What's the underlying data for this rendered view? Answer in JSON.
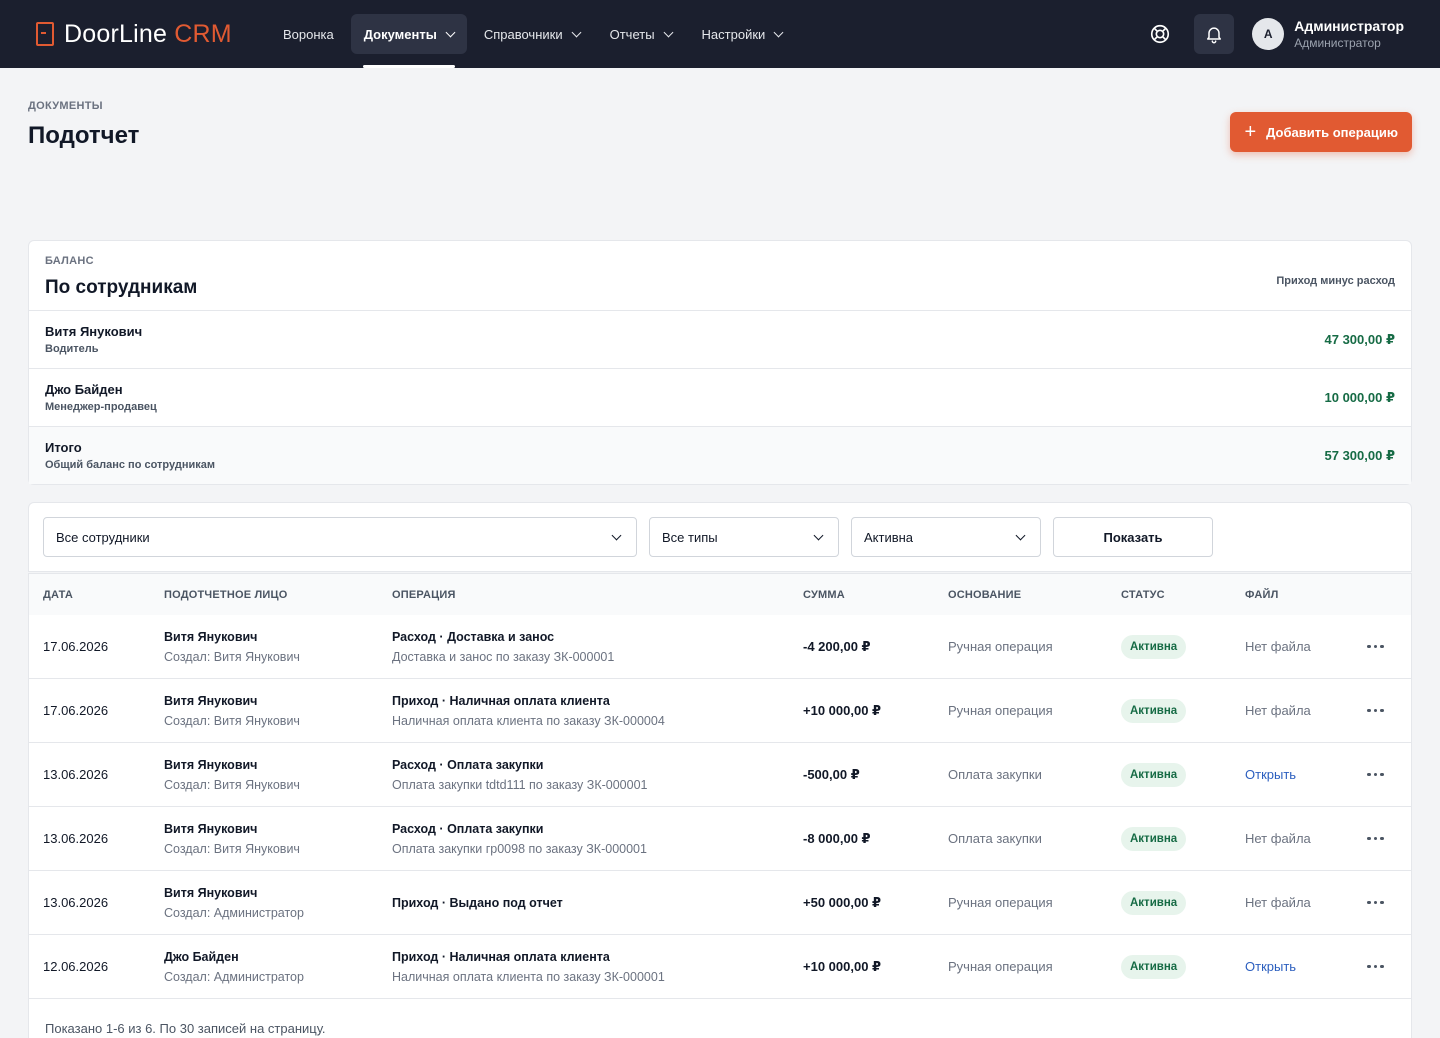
{
  "app": {
    "brand_main": "DoorLine",
    "brand_accent": "CRM"
  },
  "nav": [
    {
      "label": "Воронка",
      "has_menu": false,
      "active": false
    },
    {
      "label": "Документы",
      "has_menu": true,
      "active": true
    },
    {
      "label": "Справочники",
      "has_menu": true,
      "active": false
    },
    {
      "label": "Отчеты",
      "has_menu": true,
      "active": false
    },
    {
      "label": "Настройки",
      "has_menu": true,
      "active": false
    }
  ],
  "user": {
    "initial": "A",
    "name": "Администратор",
    "role": "Администратор"
  },
  "page": {
    "breadcrumb": "ДОКУМЕНТЫ",
    "title": "Подотчет",
    "add_button": "Добавить операцию"
  },
  "balance": {
    "label": "БАЛАНС",
    "title": "По сотрудникам",
    "hint": "Приход минус расход",
    "rows": [
      {
        "name": "Витя Янукович",
        "position": "Водитель",
        "amount": "47 300,00 ₽"
      },
      {
        "name": "Джо Байден",
        "position": "Менеджер-продавец",
        "amount": "10 000,00 ₽"
      },
      {
        "name": "Итого",
        "position": "Общий баланс по сотрудникам",
        "amount": "57 300,00 ₽"
      }
    ]
  },
  "filters": {
    "employee": "Все сотрудники",
    "type": "Все типы",
    "status": "Активна",
    "show_button": "Показать"
  },
  "table": {
    "headers": [
      "ДАТА",
      "ПОДОТЧЕТНОЕ ЛИЦО",
      "ОПЕРАЦИЯ",
      "СУММА",
      "ОСНОВАНИЕ",
      "СТАТУС",
      "ФАЙЛ"
    ],
    "rows": [
      {
        "date": "17.06.2026",
        "person": "Витя Янукович",
        "creator": "Создал: Витя Янукович",
        "operation": "Расход · Доставка и занос",
        "description": "Доставка и занос по заказу ЗК-000001",
        "amount": "-4 200,00 ₽",
        "basis": "Ручная операция",
        "status": "Активна",
        "file": "Нет файла",
        "file_link": false
      },
      {
        "date": "17.06.2026",
        "person": "Витя Янукович",
        "creator": "Создал: Витя Янукович",
        "operation": "Приход · Наличная оплата клиента",
        "description": "Наличная оплата клиента по заказу ЗК-000004",
        "amount": "+10 000,00 ₽",
        "basis": "Ручная операция",
        "status": "Активна",
        "file": "Нет файла",
        "file_link": false
      },
      {
        "date": "13.06.2026",
        "person": "Витя Янукович",
        "creator": "Создал: Витя Янукович",
        "operation": "Расход · Оплата закупки",
        "description": "Оплата закупки tdtd111 по заказу ЗК-000001",
        "amount": "-500,00 ₽",
        "basis": "Оплата закупки",
        "status": "Активна",
        "file": "Открыть",
        "file_link": true
      },
      {
        "date": "13.06.2026",
        "person": "Витя Янукович",
        "creator": "Создал: Витя Янукович",
        "operation": "Расход · Оплата закупки",
        "description": "Оплата закупки гр0098 по заказу ЗК-000001",
        "amount": "-8 000,00 ₽",
        "basis": "Оплата закупки",
        "status": "Активна",
        "file": "Нет файла",
        "file_link": false
      },
      {
        "date": "13.06.2026",
        "person": "Витя Янукович",
        "creator": "Создал: Администратор",
        "operation": "Приход · Выдано под отчет",
        "description": "",
        "amount": "+50 000,00 ₽",
        "basis": "Ручная операция",
        "status": "Активна",
        "file": "Нет файла",
        "file_link": false
      },
      {
        "date": "12.06.2026",
        "person": "Джо Байден",
        "creator": "Создал: Администратор",
        "operation": "Приход · Наличная оплата клиента",
        "description": "Наличная оплата клиента по заказу ЗК-000001",
        "amount": "+10 000,00 ₽",
        "basis": "Ручная операция",
        "status": "Активна",
        "file": "Открыть",
        "file_link": true
      }
    ],
    "footer": "Показано 1-6 из 6. По 30 записей на страницу."
  },
  "icons": {
    "help": "lifebuoy-icon",
    "notifications": "bell-icon",
    "add": "plus-icon",
    "row_menu": "more-horizontal-icon"
  },
  "colors": {
    "topbar": "#1b1f2e",
    "accent": "#e15a32",
    "positive": "#166b45",
    "link": "#2c5fbf"
  }
}
